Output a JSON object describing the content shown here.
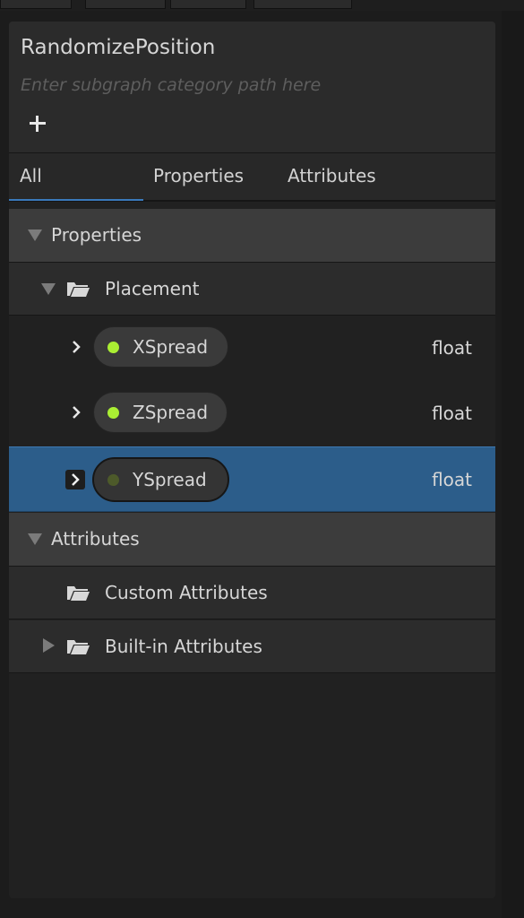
{
  "header": {
    "title": "RandomizePosition",
    "category_placeholder": "Enter subgraph category path here"
  },
  "tabs": [
    {
      "label": "All",
      "active": true
    },
    {
      "label": "Properties",
      "active": false
    },
    {
      "label": "Attributes",
      "active": false
    }
  ],
  "tree": {
    "properties": {
      "label": "Properties",
      "folders": [
        {
          "label": "Placement",
          "items": [
            {
              "name": "XSpread",
              "type": "float",
              "selected": false
            },
            {
              "name": "ZSpread",
              "type": "float",
              "selected": false
            },
            {
              "name": "YSpread",
              "type": "float",
              "selected": true
            }
          ]
        }
      ]
    },
    "attributes": {
      "label": "Attributes",
      "folders": [
        {
          "label": "Custom Attributes"
        },
        {
          "label": "Built-in Attributes"
        }
      ]
    }
  },
  "colors": {
    "accent": "#3a79bb",
    "selected_row": "#2c5d8a",
    "float_dot": "#aaee33"
  },
  "icons": [
    "add-icon",
    "triangle-down-icon",
    "triangle-right-icon",
    "folder-open-icon",
    "chevron-right-icon"
  ]
}
